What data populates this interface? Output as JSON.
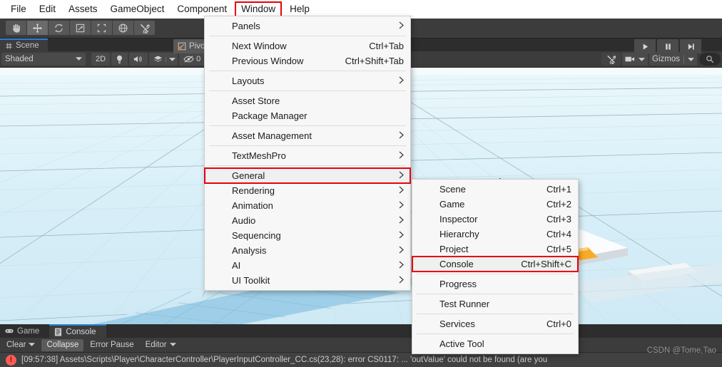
{
  "menubar": {
    "items": [
      {
        "label": "File",
        "highlighted": false
      },
      {
        "label": "Edit",
        "highlighted": false
      },
      {
        "label": "Assets",
        "highlighted": false
      },
      {
        "label": "GameObject",
        "highlighted": false
      },
      {
        "label": "Component",
        "highlighted": false
      },
      {
        "label": "Window",
        "highlighted": true
      },
      {
        "label": "Help",
        "highlighted": false
      }
    ]
  },
  "toolbar": {
    "tools": [
      {
        "name": "hand-tool",
        "active": false
      },
      {
        "name": "move-tool",
        "active": true
      },
      {
        "name": "rotate-tool",
        "active": false
      },
      {
        "name": "scale-tool",
        "active": false
      },
      {
        "name": "rect-tool",
        "active": false
      },
      {
        "name": "transform-tool",
        "active": false
      },
      {
        "name": "custom-tool",
        "active": false
      }
    ],
    "pivot_label": "Pivot",
    "play_controls": [
      {
        "name": "play-button",
        "glyph": "play"
      },
      {
        "name": "pause-button",
        "glyph": "pause"
      },
      {
        "name": "step-button",
        "glyph": "step"
      }
    ]
  },
  "scene_panel": {
    "tab_label": "Scene",
    "draw_mode": "Shaded",
    "toggle_2d": "2D",
    "effects_count": "0",
    "gizmos_label": "Gizmos"
  },
  "console_panel": {
    "tabs": [
      {
        "label": "Game",
        "selected": false,
        "icon": "gamepad-icon"
      },
      {
        "label": "Console",
        "selected": true,
        "icon": "console-icon"
      }
    ],
    "buttons": [
      {
        "label": "Clear",
        "toggled": false,
        "has_caret": true
      },
      {
        "label": "Collapse",
        "toggled": true,
        "has_caret": false
      },
      {
        "label": "Error Pause",
        "toggled": false,
        "has_caret": false
      },
      {
        "label": "Editor",
        "toggled": false,
        "has_caret": true
      }
    ],
    "log_entry": {
      "severity": "error",
      "text": "[09:57:38] Assets\\Scripts\\Player\\CharacterController\\PlayerInputController_CC.cs(23,28): error CS0117: ... 'outValue' could not be found (are you"
    }
  },
  "watermark": "CSDN @Tome,Tao",
  "window_menu": {
    "groups": [
      {
        "items": [
          {
            "label": "Panels",
            "shortcut": "",
            "submenu": true,
            "boxed": false
          }
        ]
      },
      {
        "items": [
          {
            "label": "Next Window",
            "shortcut": "Ctrl+Tab",
            "submenu": false,
            "boxed": false
          },
          {
            "label": "Previous Window",
            "shortcut": "Ctrl+Shift+Tab",
            "submenu": false,
            "boxed": false
          }
        ]
      },
      {
        "items": [
          {
            "label": "Layouts",
            "shortcut": "",
            "submenu": true,
            "boxed": false
          }
        ]
      },
      {
        "items": [
          {
            "label": "Asset Store",
            "shortcut": "",
            "submenu": false,
            "boxed": false
          },
          {
            "label": "Package Manager",
            "shortcut": "",
            "submenu": false,
            "boxed": false
          }
        ]
      },
      {
        "items": [
          {
            "label": "Asset Management",
            "shortcut": "",
            "submenu": true,
            "boxed": false
          }
        ]
      },
      {
        "items": [
          {
            "label": "TextMeshPro",
            "shortcut": "",
            "submenu": true,
            "boxed": false
          }
        ]
      },
      {
        "items": [
          {
            "label": "General",
            "shortcut": "",
            "submenu": true,
            "boxed": true
          },
          {
            "label": "Rendering",
            "shortcut": "",
            "submenu": true,
            "boxed": false
          },
          {
            "label": "Animation",
            "shortcut": "",
            "submenu": true,
            "boxed": false
          },
          {
            "label": "Audio",
            "shortcut": "",
            "submenu": true,
            "boxed": false
          },
          {
            "label": "Sequencing",
            "shortcut": "",
            "submenu": true,
            "boxed": false
          },
          {
            "label": "Analysis",
            "shortcut": "",
            "submenu": true,
            "boxed": false
          },
          {
            "label": "AI",
            "shortcut": "",
            "submenu": true,
            "boxed": false
          },
          {
            "label": "UI Toolkit",
            "shortcut": "",
            "submenu": true,
            "boxed": false
          }
        ]
      }
    ]
  },
  "general_submenu": {
    "groups": [
      {
        "items": [
          {
            "label": "Scene",
            "shortcut": "Ctrl+1",
            "submenu": false,
            "boxed": false
          },
          {
            "label": "Game",
            "shortcut": "Ctrl+2",
            "submenu": false,
            "boxed": false
          },
          {
            "label": "Inspector",
            "shortcut": "Ctrl+3",
            "submenu": false,
            "boxed": false
          },
          {
            "label": "Hierarchy",
            "shortcut": "Ctrl+4",
            "submenu": false,
            "boxed": false
          },
          {
            "label": "Project",
            "shortcut": "Ctrl+5",
            "submenu": false,
            "boxed": false
          },
          {
            "label": "Console",
            "shortcut": "Ctrl+Shift+C",
            "submenu": false,
            "boxed": true
          }
        ]
      },
      {
        "items": [
          {
            "label": "Progress",
            "shortcut": "",
            "submenu": false,
            "boxed": false
          }
        ]
      },
      {
        "items": [
          {
            "label": "Test Runner",
            "shortcut": "",
            "submenu": false,
            "boxed": false
          }
        ]
      },
      {
        "items": [
          {
            "label": "Services",
            "shortcut": "Ctrl+0",
            "submenu": false,
            "boxed": false
          }
        ]
      },
      {
        "items": [
          {
            "label": "Active Tool",
            "shortcut": "",
            "submenu": false,
            "boxed": false
          }
        ]
      }
    ]
  },
  "colors": {
    "highlight_red": "#e8000a",
    "accent_blue": "#2c7fd0",
    "error_red": "#ff5c55",
    "menu_bg": "#f7f7f7",
    "chrome_dark": "#3c3c3c"
  }
}
